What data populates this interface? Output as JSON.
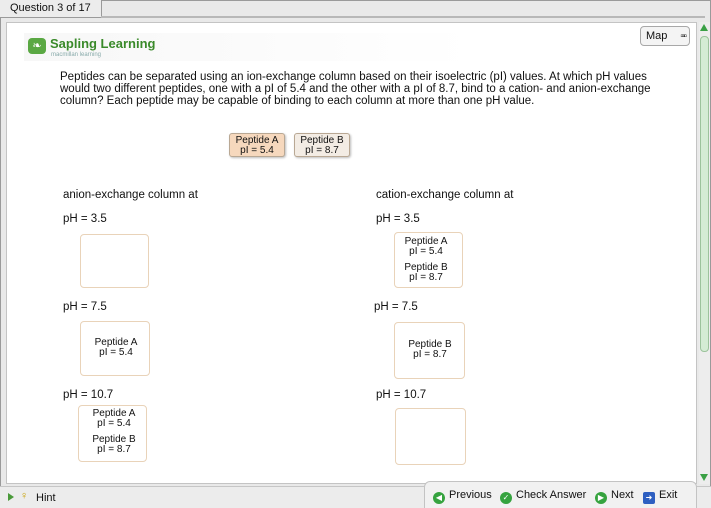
{
  "header": {
    "tab_label": "Question 3 of 17"
  },
  "logo": {
    "title": "Sapling Learning",
    "subtitle": "macmillan learning"
  },
  "map": {
    "label": "Map"
  },
  "question": {
    "text": "Peptides can be separated using an ion-exchange column based on their isoelectric (pI) values. At which pH values would two different peptides, one with a pI of 5.4 and the other with a pI of 8.7, bind to a cation- and anion-exchange column? Each peptide may be capable of binding to each column at more than one pH value."
  },
  "chips": [
    {
      "name": "Peptide A",
      "pi": "pI = 5.4"
    },
    {
      "name": "Peptide B",
      "pi": "pI = 8.7"
    }
  ],
  "columns": {
    "anion": {
      "header": "anion-exchange column at",
      "rows": [
        {
          "ph": "pH = 3.5",
          "items": []
        },
        {
          "ph": "pH = 7.5",
          "items": [
            {
              "name": "Peptide A",
              "pi": "pI = 5.4"
            }
          ]
        },
        {
          "ph": "pH = 10.7",
          "items": [
            {
              "name": "Peptide A",
              "pi": "pI = 5.4"
            },
            {
              "name": "Peptide B",
              "pi": "pI = 8.7"
            }
          ]
        }
      ]
    },
    "cation": {
      "header": "cation-exchange column at",
      "rows": [
        {
          "ph": "pH = 3.5",
          "items": [
            {
              "name": "Peptide A",
              "pi": "pI = 5.4"
            },
            {
              "name": "Peptide B",
              "pi": "pI = 8.7"
            }
          ]
        },
        {
          "ph": "pH = 7.5",
          "items": [
            {
              "name": "Peptide B",
              "pi": "pI = 8.7"
            }
          ]
        },
        {
          "ph": "pH = 10.7",
          "items": []
        }
      ]
    }
  },
  "footer": {
    "hint": "Hint",
    "previous": "Previous",
    "check": "Check Answer",
    "next": "Next",
    "exit": "Exit"
  },
  "colors": {
    "accent_green": "#36a33f",
    "chip_a": "#f6d8bd",
    "chip_b": "#f3ece4",
    "drop_border": "#e9d3b9"
  }
}
